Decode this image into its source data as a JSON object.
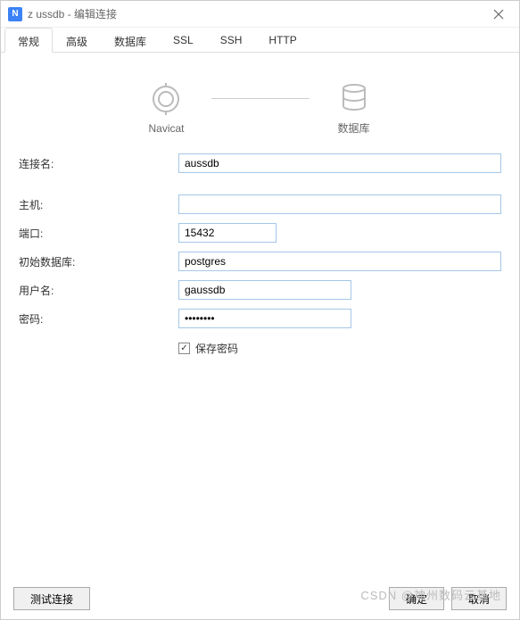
{
  "titlebar": {
    "icon_letter": "N",
    "title": "z   ussdb - 编辑连接"
  },
  "tabs": [
    {
      "label": "常规",
      "active": true
    },
    {
      "label": "高级",
      "active": false
    },
    {
      "label": "数据库",
      "active": false
    },
    {
      "label": "SSL",
      "active": false
    },
    {
      "label": "SSH",
      "active": false
    },
    {
      "label": "HTTP",
      "active": false
    }
  ],
  "diagram": {
    "left_label": "Navicat",
    "right_label": "数据库"
  },
  "fields": {
    "connection_name": {
      "label": "连接名:",
      "value": "aussdb"
    },
    "host": {
      "label": "主机:",
      "value": ""
    },
    "port": {
      "label": "端口:",
      "value": "15432"
    },
    "initial_db": {
      "label": "初始数据库:",
      "value": "postgres"
    },
    "username": {
      "label": "用户名:",
      "value": "gaussdb"
    },
    "password": {
      "label": "密码:",
      "value": "••••••••"
    },
    "save_password": {
      "label": "保存密码",
      "checked": true
    }
  },
  "footer": {
    "test_connection": "测试连接",
    "ok": "确定",
    "cancel": "取消"
  },
  "watermark": "CSDN @神州数码云基地"
}
